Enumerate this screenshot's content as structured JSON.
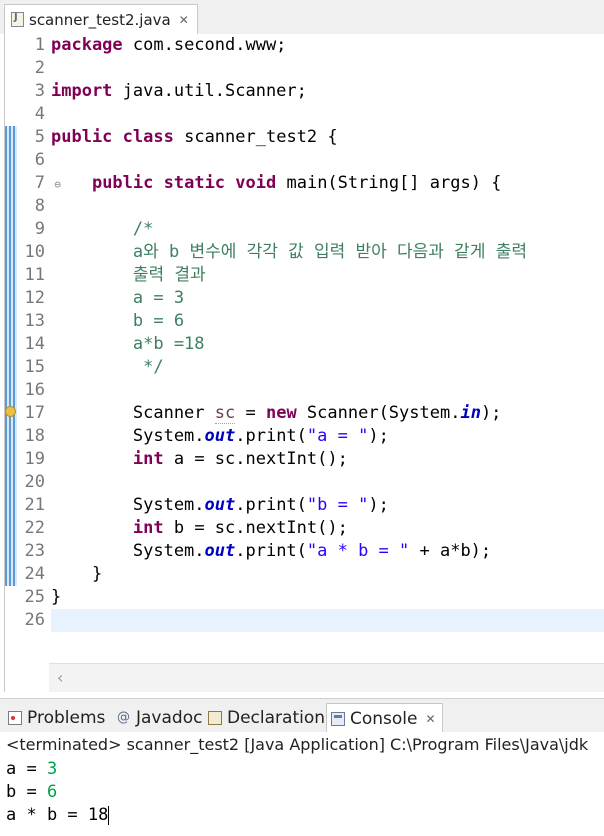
{
  "editor_tab": {
    "title": "scanner_test2.java",
    "close": "✕"
  },
  "line_numbers": [
    "1",
    "2",
    "3",
    "4",
    "5",
    "6",
    "7",
    "8",
    "9",
    "10",
    "11",
    "12",
    "13",
    "14",
    "15",
    "16",
    "17",
    "18",
    "19",
    "20",
    "21",
    "22",
    "23",
    "24",
    "25",
    "26"
  ],
  "code": {
    "l1": {
      "kw": "package",
      "rest": " com.second.www;"
    },
    "l3": {
      "kw": "import",
      "rest": " java.util.Scanner;"
    },
    "l5": {
      "kw1": "public",
      "kw2": "class",
      "rest": " scanner_test2 {"
    },
    "l7": {
      "indent": "    ",
      "kw1": "public",
      "kw2": "static",
      "kw3": "void",
      "rest": " main(String[] args) {"
    },
    "l9": "        /*",
    "l10": "        a와 b 변수에 각각 값 입력 받아 다음과 같게 출력",
    "l11": "        출력 결과",
    "l12": "        a = 3",
    "l13": "        b = 6",
    "l14": "        a*b =18",
    "l15": "         */",
    "l17": {
      "pre": "        Scanner ",
      "var": "sc",
      "mid": " = ",
      "kw": "new",
      "post": " Scanner(System.",
      "fld": "in",
      "end": ");"
    },
    "l18": {
      "pre": "        System.",
      "fld": "out",
      "mid": ".print(",
      "str": "\"a = \"",
      "end": ");"
    },
    "l19": {
      "pre": "        ",
      "kw": "int",
      "rest": " a = sc.nextInt();"
    },
    "l21": {
      "pre": "        System.",
      "fld": "out",
      "mid": ".print(",
      "str": "\"b = \"",
      "end": ");"
    },
    "l22": {
      "pre": "        ",
      "kw": "int",
      "rest": " b = sc.nextInt();"
    },
    "l23": {
      "pre": "        System.",
      "fld": "out",
      "mid": ".print(",
      "str": "\"a * b = \"",
      "end": " + a*b);"
    },
    "l24": "    }",
    "l25": "}"
  },
  "panel_tabs": {
    "problems": "Problems",
    "javadoc": "Javadoc",
    "declaration": "Declaration",
    "console": "Console",
    "close": "✕"
  },
  "console": {
    "status": "<terminated> scanner_test2 [Java Application] C:\\Program Files\\Java\\jdk",
    "lines": [
      {
        "prompt": "a = ",
        "value": "3"
      },
      {
        "prompt": "b = ",
        "value": "6"
      },
      {
        "prompt": "a * b = 18",
        "value": ""
      }
    ]
  },
  "icons": {
    "tab": "java-file-icon",
    "problems": "problems-icon",
    "javadoc": "javadoc-icon",
    "declaration": "declaration-icon",
    "console": "console-icon"
  },
  "colors": {
    "keyword": "#7f0055",
    "comment": "#3f7f5f",
    "string": "#2a00ff",
    "field": "#0000c0",
    "console_input": "#00a04a",
    "current_line": "#e8f2fe"
  }
}
